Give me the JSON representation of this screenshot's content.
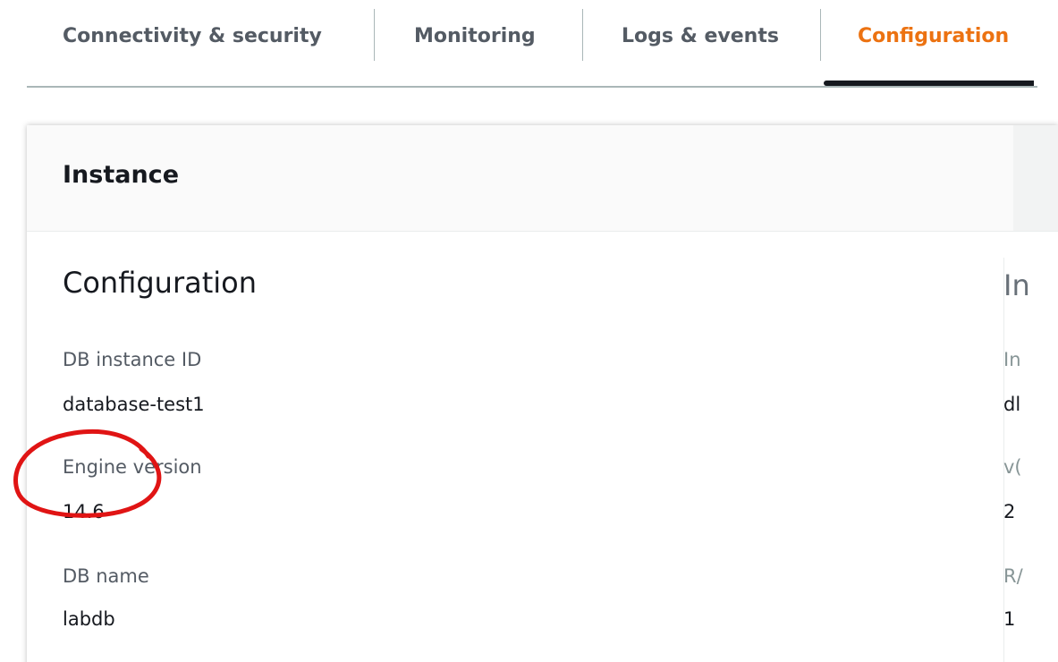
{
  "tabs": [
    {
      "label": "Connectivity & security"
    },
    {
      "label": "Monitoring"
    },
    {
      "label": "Logs & events"
    },
    {
      "label": "Configuration"
    }
  ],
  "active_tab": "Configuration",
  "colors": {
    "accent": "#ec7211",
    "text": "#16191f",
    "muted": "#545b64"
  },
  "panel": {
    "title": "Instance",
    "section_title": "Configuration",
    "fields": [
      {
        "label": "DB instance ID",
        "value": "database-test1"
      },
      {
        "label": "Engine version",
        "value": "14.6"
      },
      {
        "label": "DB name",
        "value": "labdb"
      }
    ],
    "right_column": {
      "title": "In",
      "items": [
        "In",
        "dl",
        "v(",
        "2",
        "R/",
        "1"
      ]
    }
  },
  "annotation": {
    "color": "#e01414",
    "shape": "ellipse-highlight"
  }
}
